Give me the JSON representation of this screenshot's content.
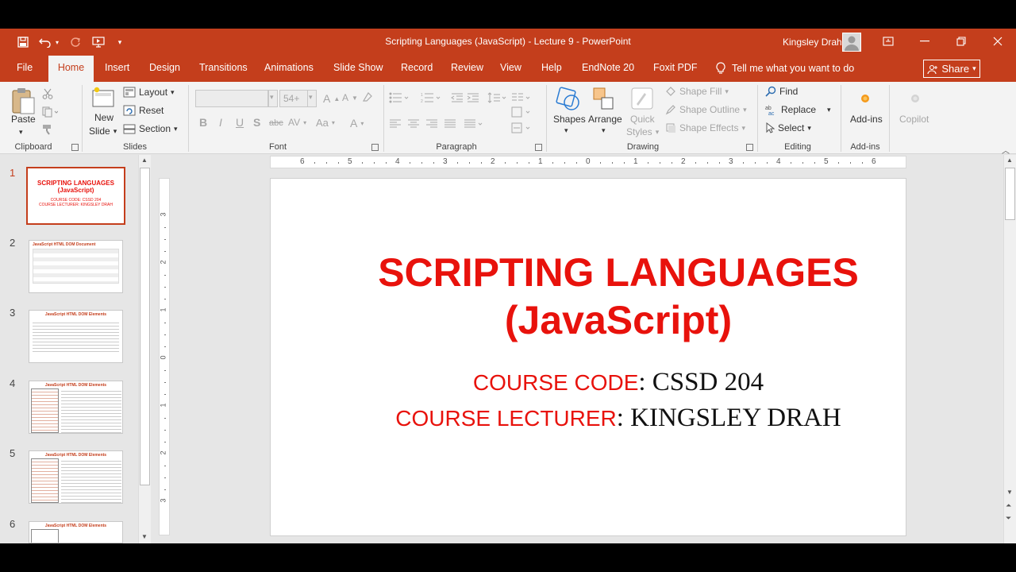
{
  "window": {
    "title": "Scripting Languages (JavaScript) - Lecture 9  -  PowerPoint",
    "user": "Kingsley Drah"
  },
  "tabs": [
    "File",
    "Home",
    "Insert",
    "Design",
    "Transitions",
    "Animations",
    "Slide Show",
    "Record",
    "Review",
    "View",
    "Help",
    "EndNote 20",
    "Foxit PDF"
  ],
  "active_tab": "Home",
  "tell_me": "Tell me what you want to do",
  "share_label": "Share",
  "ribbon": {
    "clipboard": {
      "paste": "Paste",
      "label": "Clipboard"
    },
    "slides": {
      "new_slide_1": "New",
      "new_slide_2": "Slide",
      "layout": "Layout",
      "reset": "Reset",
      "section": "Section",
      "label": "Slides"
    },
    "font": {
      "size": "54+",
      "label": "Font"
    },
    "paragraph": {
      "label": "Paragraph"
    },
    "drawing": {
      "shapes": "Shapes",
      "arrange": "Arrange",
      "quick_1": "Quick",
      "quick_2": "Styles",
      "shape_fill": "Shape Fill",
      "shape_outline": "Shape Outline",
      "shape_effects": "Shape Effects",
      "label": "Drawing"
    },
    "editing": {
      "find": "Find",
      "replace": "Replace",
      "select": "Select",
      "label": "Editing"
    },
    "addins": {
      "addins": "Add-ins",
      "label": "Add-ins"
    },
    "copilot": "Copilot"
  },
  "thumbnails": [
    {
      "num": "1",
      "title": "SCRIPTING LANGUAGES",
      "subtitle": "(JavaScript)",
      "line1": "COURSE CODE: CSSD 204",
      "line2": "COURSE LECTURER: KINGSLEY DRAH"
    },
    {
      "num": "2",
      "title": "JavaScript HTML DOM Document"
    },
    {
      "num": "3",
      "title": "JavaScript HTML DOM Elements"
    },
    {
      "num": "4",
      "title": "JavaScript HTML DOM Elements"
    },
    {
      "num": "5",
      "title": "JavaScript HTML DOM Elements"
    },
    {
      "num": "6",
      "title": "JavaScript HTML DOM Elements"
    }
  ],
  "ruler_h": [
    "6",
    "5",
    "4",
    "3",
    "2",
    "1",
    "0",
    "1",
    "2",
    "3",
    "4",
    "5",
    "6"
  ],
  "ruler_v": [
    "3",
    "2",
    "1",
    "0",
    "1",
    "2",
    "3"
  ],
  "slide": {
    "title_line1": "SCRIPTING LANGUAGES",
    "title_line2": "(JavaScript)",
    "code_label": "COURSE CODE",
    "code_value": ": CSSD 204",
    "lecturer_label": "COURSE LECTURER",
    "lecturer_value": ": KINGSLEY DRAH"
  },
  "colors": {
    "accent": "#c43e1c",
    "slide_red": "#e8120c"
  }
}
